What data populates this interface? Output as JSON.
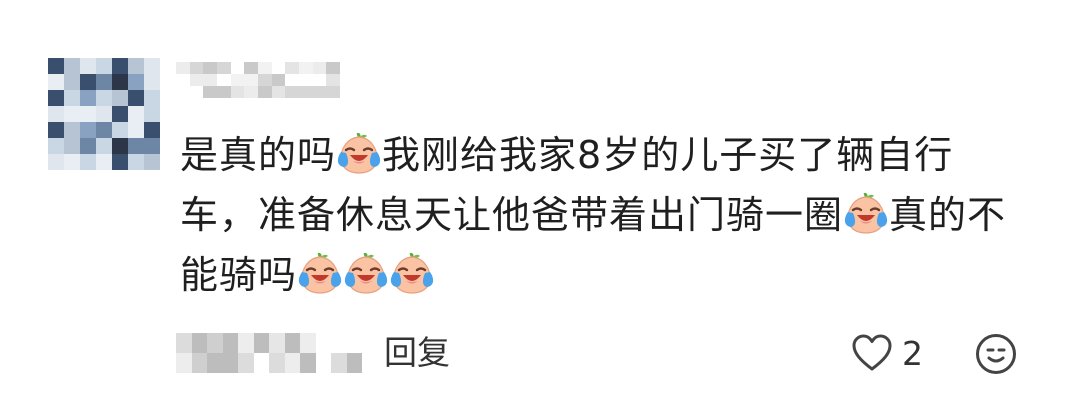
{
  "comment": {
    "lines": [
      [
        {
          "t": "是真的吗"
        },
        {
          "e": "crying-laughing-emoji"
        },
        {
          "t": "我刚给我家8岁的儿子买了辆自行"
        }
      ],
      [
        {
          "t": "车，准备休息天让他爸带着出门骑一圈"
        },
        {
          "e": "crying-laughing-emoji"
        },
        {
          "t": "真的不"
        }
      ],
      [
        {
          "t": "能骑吗"
        },
        {
          "e": "crying-laughing-emoji"
        },
        {
          "e": "crying-laughing-emoji"
        },
        {
          "e": "crying-laughing-emoji"
        }
      ]
    ]
  },
  "actions": {
    "reply_label": "回复",
    "like_count": "2"
  },
  "icons": {
    "like": "heart-outline-icon",
    "emoji": "smiley-face-icon",
    "inline": "crying-laughing-emoji"
  },
  "colors": {
    "text": "#1f1f1f",
    "action_text": "#333333",
    "icon_stroke": "#444444",
    "blur_gray": "#cfcfcf"
  }
}
